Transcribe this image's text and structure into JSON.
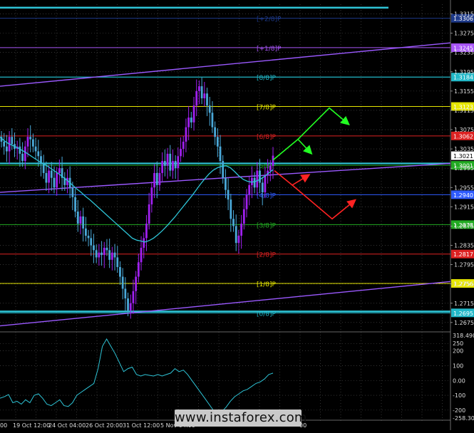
{
  "watermark": "www.instaforex.com",
  "price_axis": {
    "labels": [
      "1.3315",
      "1.3275",
      "1.3235",
      "1.3195",
      "1.3155",
      "1.3115",
      "1.3075",
      "1.3035",
      "1.2995",
      "1.2955",
      "1.2915",
      "1.2875",
      "1.2835",
      "1.2795",
      "1.2755",
      "1.2715",
      "1.2675"
    ],
    "current_price": "1.3021"
  },
  "indicator_axis": {
    "labels": [
      "318.4907",
      "250",
      "200",
      "100",
      "0.00",
      "-100",
      "-200",
      "-258.301"
    ]
  },
  "time_axis": {
    "labels": [
      "00",
      "19 Oct 12:00",
      "24 Oct 04:00",
      "26 Oct 20:00",
      "31 Oct 12:00",
      "5 Nov 04:00",
      "00"
    ]
  },
  "murrey_levels": [
    {
      "label": "[+2/8]P",
      "price": 1.3306,
      "box": "1.3306",
      "color": "#1e3a8a"
    },
    {
      "label": "[+1/8]P",
      "price": 1.3245,
      "box": "1.3245",
      "color": "#a855f7"
    },
    {
      "label": "[8/8]P",
      "price": 1.3184,
      "box": "1.3184",
      "color": "#22b8c8"
    },
    {
      "label": "[7/8]P",
      "price": 1.3123,
      "box": "1.3123",
      "color": "#e5e500"
    },
    {
      "label": "[6/8]P",
      "price": 1.3062,
      "box": "1.3062",
      "color": "#dd2222"
    },
    {
      "label": "[5/8]P",
      "price": 1.3001,
      "box": "1.3001",
      "color": "#22aa22"
    },
    {
      "label": "[4/8]P",
      "price": 1.294,
      "box": "1.2940",
      "color": "#2f5bff"
    },
    {
      "label": "[3/8]P",
      "price": 1.2878,
      "box": "1.2878",
      "color": "#22aa22"
    },
    {
      "label": "[2/8]P",
      "price": 1.2817,
      "box": "1.2817",
      "color": "#dd2222"
    },
    {
      "label": "[1/8]P",
      "price": 1.2756,
      "box": "1.2756",
      "color": "#e5e500"
    },
    {
      "label": "[0/8]P",
      "price": 1.2695,
      "box": "1.2695",
      "color": "#22b8c8"
    }
  ],
  "colors": {
    "background": "#000000",
    "grid": "#555555",
    "bull_candle": "#a020f0",
    "bear_candle": "#4aa8d8",
    "moving_average": "#2ec4d6",
    "regression_channel": "#9b59ff",
    "forecast_up": "#22ff22",
    "forecast_down": "#ff2222",
    "price_box": "#ffffff"
  },
  "chart_data": [
    {
      "type": "candlestick",
      "ylim": [
        1.266,
        1.3335
      ],
      "x": "4H bars, 18 Oct – 8 Nov",
      "closes": [
        1.305,
        1.304,
        1.303,
        1.306,
        1.3045,
        1.3035,
        1.304,
        1.3025,
        1.301,
        1.304,
        1.306,
        1.3055,
        1.304,
        1.303,
        1.302,
        1.3005,
        1.2985,
        1.2965,
        1.299,
        1.2975,
        1.2955,
        1.2985,
        1.2995,
        1.2975,
        1.296,
        1.2975,
        1.2955,
        1.2935,
        1.2905,
        1.288,
        1.2895,
        1.287,
        1.2855,
        1.285,
        1.2835,
        1.2825,
        1.281,
        1.282,
        1.2815,
        1.283,
        1.2825,
        1.2805,
        1.282,
        1.281,
        1.279,
        1.277,
        1.2745,
        1.2725,
        1.27,
        1.2715,
        1.274,
        1.277,
        1.28,
        1.283,
        1.285,
        1.288,
        1.292,
        1.2955,
        1.2985,
        1.296,
        1.2985,
        1.301,
        1.3,
        1.3025,
        1.299,
        1.301,
        1.2995,
        1.302,
        1.3035,
        1.305,
        1.308,
        1.31,
        1.309,
        1.3125,
        1.3155,
        1.3165,
        1.314,
        1.315,
        1.3125,
        1.311,
        1.308,
        1.306,
        1.304,
        1.301,
        1.2975,
        1.295,
        1.293,
        1.289,
        1.2875,
        1.284,
        1.2855,
        1.288,
        1.291,
        1.294,
        1.296,
        1.2975,
        1.2955,
        1.299,
        1.2965,
        1.2945,
        1.298,
        1.299,
        1.3,
        1.3021
      ],
      "moving_average": [
        1.306,
        1.3052,
        1.3046,
        1.3042,
        1.3038,
        1.3033,
        1.3028,
        1.3022,
        1.3016,
        1.301,
        1.3005,
        1.3,
        1.2994,
        1.2988,
        1.2982,
        1.2975,
        1.2968,
        1.296,
        1.2952,
        1.2945,
        1.2937,
        1.293,
        1.2922,
        1.2914,
        1.2906,
        1.2898,
        1.289,
        1.2882,
        1.2874,
        1.2866,
        1.2858,
        1.285,
        1.2846,
        1.2844,
        1.2842,
        1.2845,
        1.285,
        1.2857,
        1.2865,
        1.2874,
        1.2884,
        1.2894,
        1.2905,
        1.2916,
        1.2927,
        1.2938,
        1.295,
        1.2962,
        1.2973,
        1.2983,
        1.2991,
        1.2996,
        1.2999,
        1.3,
        1.2996,
        1.2988,
        1.2979,
        1.2972,
        1.2968,
        1.2966,
        1.2968,
        1.2972,
        1.2978,
        1.2985,
        1.2992
      ],
      "indicator": {
        "name": "CCI",
        "values": [
          -120,
          -110,
          -95,
          -150,
          -140,
          -160,
          -130,
          -150,
          -100,
          -90,
          -120,
          -160,
          -170,
          -150,
          -130,
          -170,
          -175,
          -150,
          -100,
          -80,
          -60,
          -40,
          -20,
          80,
          230,
          280,
          230,
          180,
          120,
          60,
          80,
          90,
          40,
          30,
          40,
          35,
          30,
          40,
          30,
          40,
          50,
          80,
          60,
          70,
          40,
          0,
          -40,
          -80,
          -120,
          -160,
          -200,
          -220,
          -210,
          -180,
          -140,
          -110,
          -90,
          -70,
          -60,
          -40,
          -20,
          -10,
          10,
          40,
          50
        ],
        "ylim": [
          -258.301,
          318.4907
        ],
        "levels": [
          250,
          200,
          100,
          0,
          -100,
          -200
        ]
      }
    }
  ]
}
